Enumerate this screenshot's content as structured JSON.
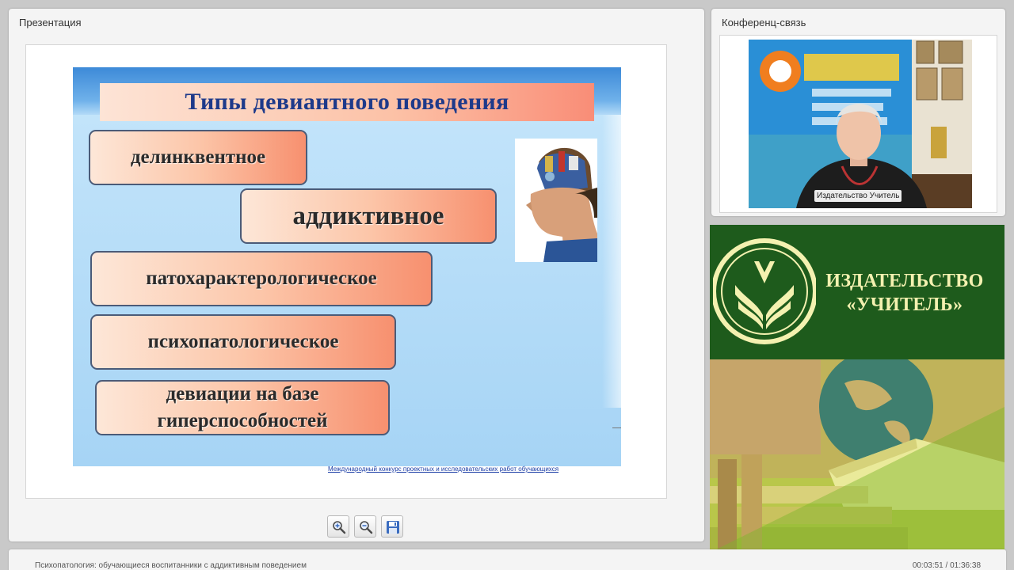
{
  "presentation_panel": {
    "title": "Презентация",
    "slide": {
      "title": "Типы девиантного поведения",
      "types": [
        "делинквентное",
        "аддиктивное",
        "патохарактерологическое",
        "психопатологическое",
        "девиации на базе гиперспособностей"
      ],
      "caption": "Международный конкурс проектных и исследовательских работ обучающихся"
    },
    "toolbar": {
      "zoom_in_icon": "zoom-in-icon",
      "zoom_out_icon": "zoom-out-icon",
      "save_icon": "floppy-disk-icon"
    }
  },
  "conference_panel": {
    "title": "Конференц-связь",
    "video_label": "Издательство Учитель"
  },
  "publisher_banner": {
    "name_line1": "ИЗДАТЕЛЬСТВО",
    "name_line2": "«УЧИТЕЛЬ»"
  },
  "status_bar": {
    "webinar_title": "Психопатология: обучающиеся воспитанники с аддиктивным поведением",
    "time": "00:03:51 / 01:36:38"
  },
  "colors": {
    "slide_title_text": "#1e3a8a",
    "banner_green": "#1e5b1c",
    "banner_text": "#f4f1b0",
    "link_blue": "#1a3ca5"
  }
}
